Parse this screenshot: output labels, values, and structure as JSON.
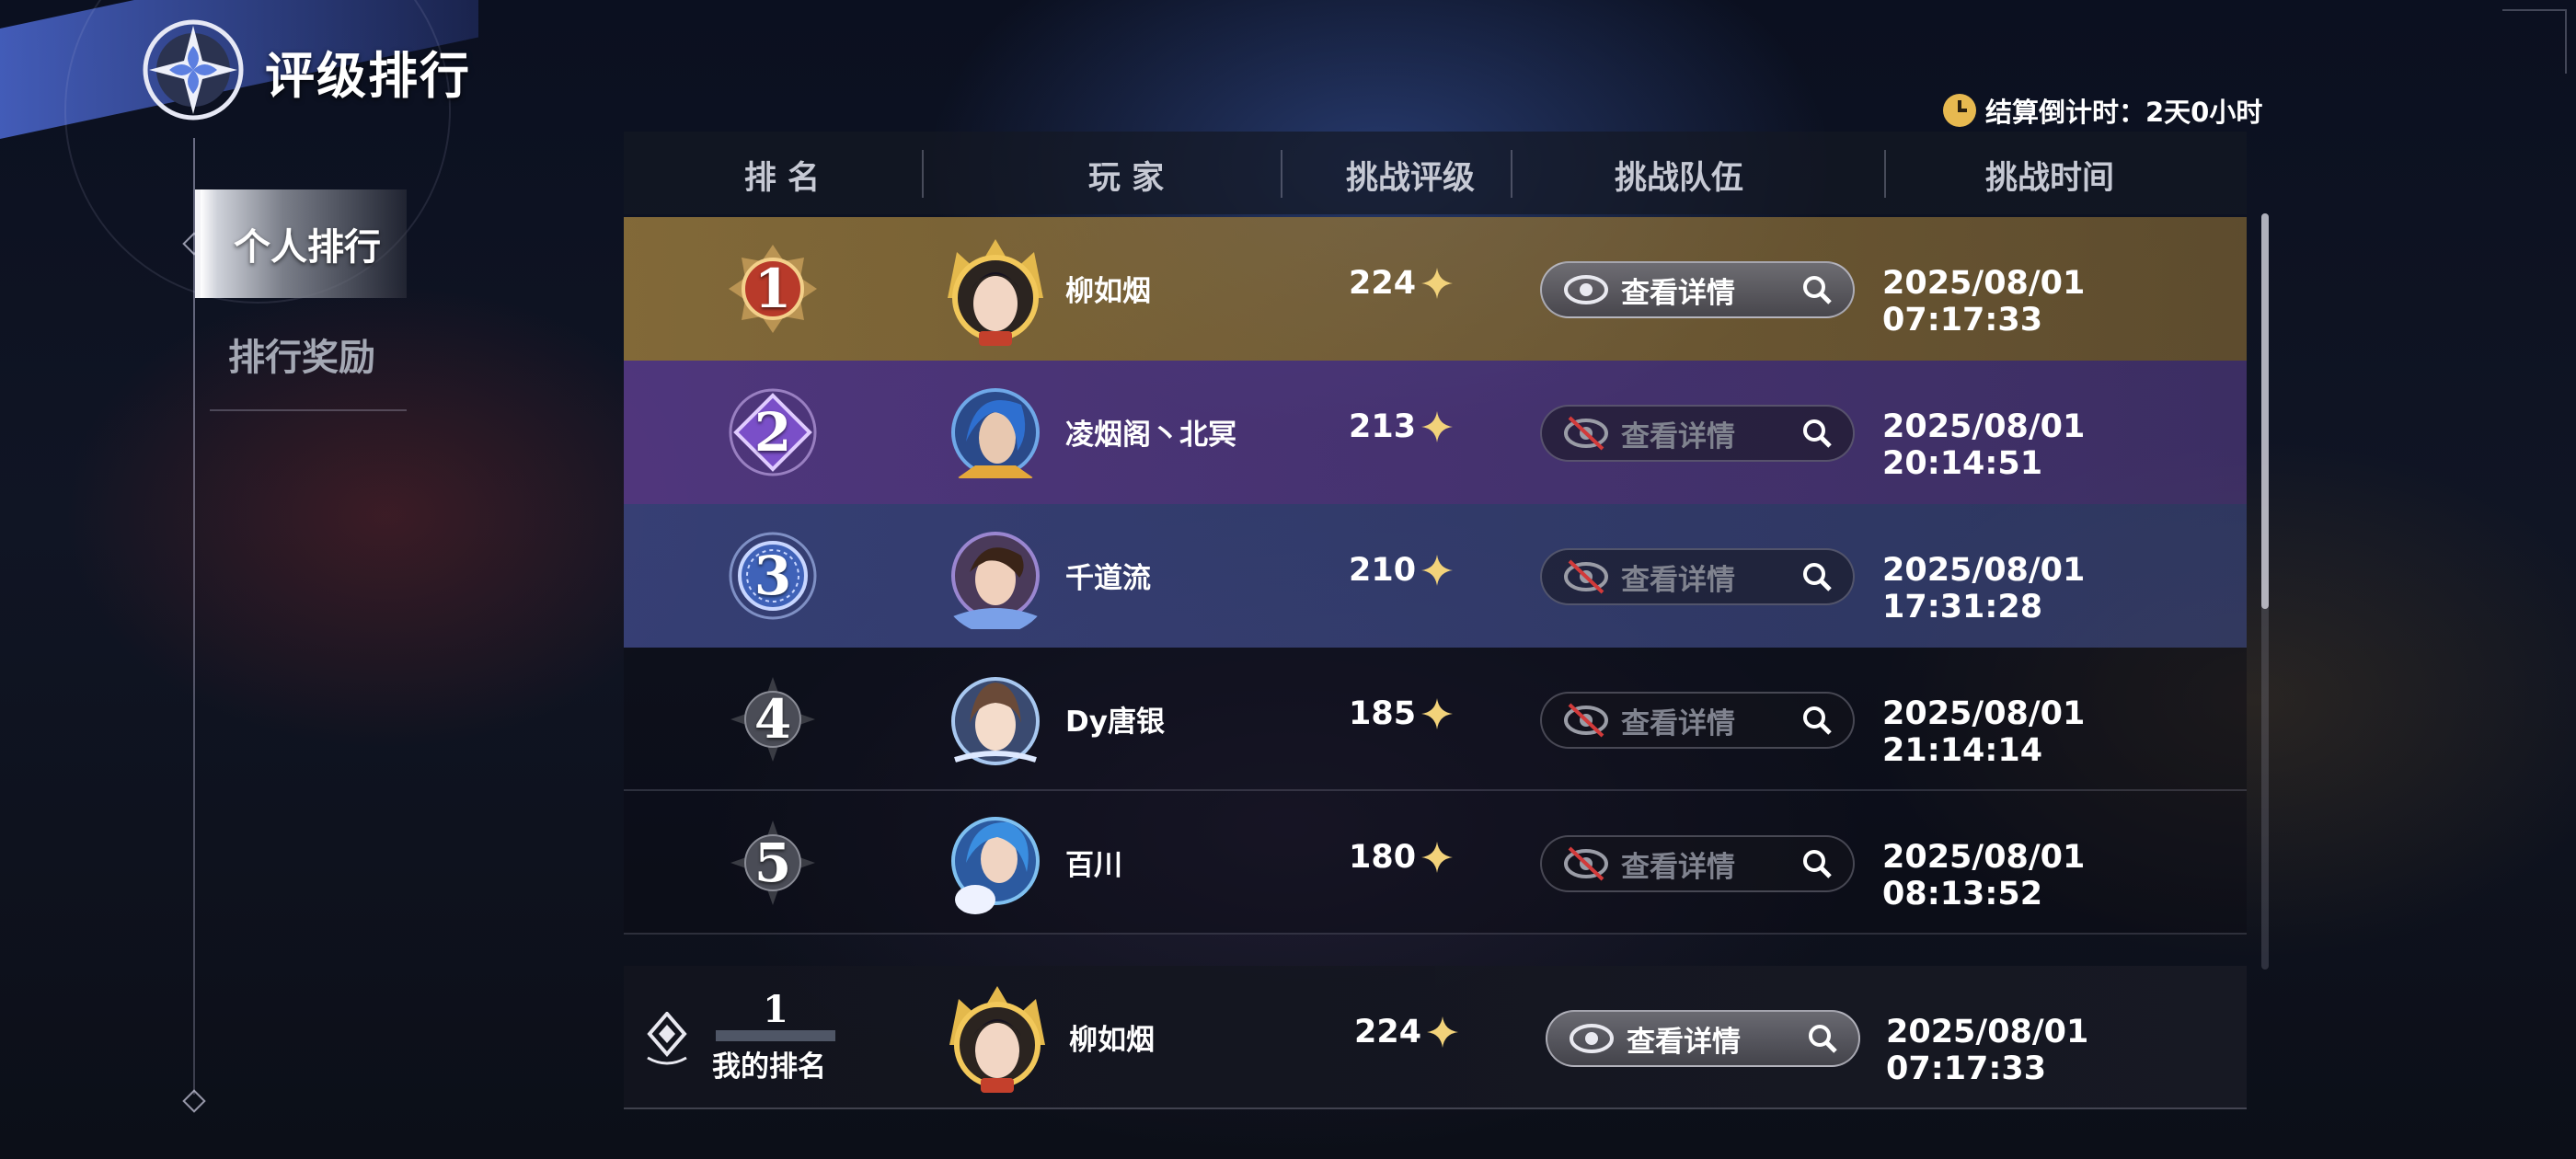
{
  "header": {
    "title": "评级排行",
    "countdown": "结算倒计时：2天0小时"
  },
  "nav": {
    "items": [
      {
        "label": "个人排行",
        "active": true
      },
      {
        "label": "排行奖励",
        "active": false
      }
    ]
  },
  "table": {
    "columns": [
      "排  名",
      "玩  家",
      "挑战评级",
      "挑战队伍",
      "挑战时间"
    ],
    "view_label": "查看详情",
    "rows": [
      {
        "rank": "1",
        "player": "柳如烟",
        "score": "224",
        "time": "2025/08/01 07:17:33",
        "viewable": true
      },
      {
        "rank": "2",
        "player": "凌烟阁丶北冥",
        "score": "213",
        "time": "2025/08/01 20:14:51",
        "viewable": false
      },
      {
        "rank": "3",
        "player": "千道流",
        "score": "210",
        "time": "2025/08/01 17:31:28",
        "viewable": false
      },
      {
        "rank": "4",
        "player": "Dy唐银",
        "score": "185",
        "time": "2025/08/01 21:14:14",
        "viewable": false
      },
      {
        "rank": "5",
        "player": "百川",
        "score": "180",
        "time": "2025/08/01 08:13:52",
        "viewable": false
      }
    ]
  },
  "my_rank": {
    "rank": "1",
    "label": "我的排名",
    "player": "柳如烟",
    "score": "224",
    "view_label": "查看详情",
    "time": "2025/08/01 07:17:33"
  },
  "colors": {
    "rank1": "#9a7a3c",
    "rank2": "#5a3c8c",
    "rank3": "#3c4682",
    "star": "#f2d27a",
    "clock": "#e7b950"
  }
}
